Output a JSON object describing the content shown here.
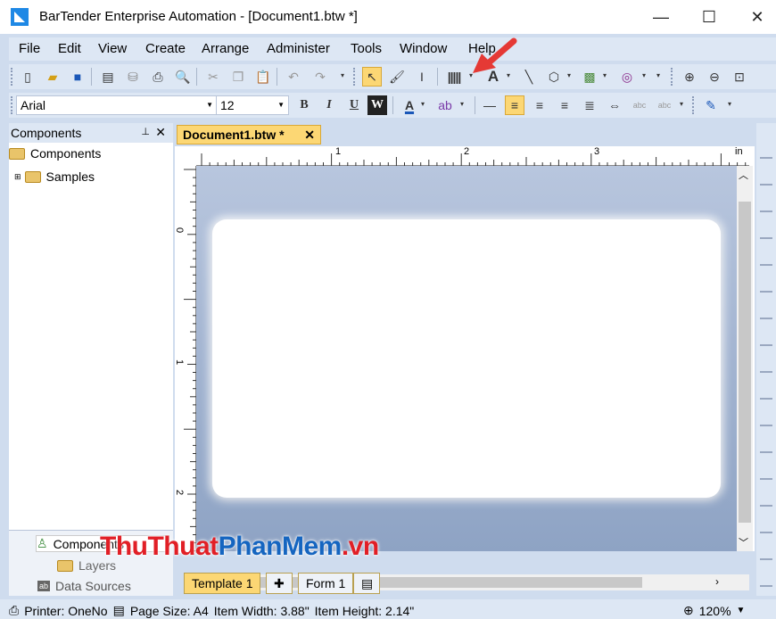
{
  "window": {
    "title": "BarTender Enterprise Automation - [Document1.btw *]",
    "minimize": "—",
    "maximize": "☐",
    "close": "✕"
  },
  "menu": [
    "File",
    "Edit",
    "View",
    "Create",
    "Arrange",
    "Administer",
    "Tools",
    "Window",
    "Help"
  ],
  "font": {
    "name": "Arial",
    "size": "12"
  },
  "format_buttons": {
    "bold": "B",
    "italic": "I",
    "underline": "U",
    "word": "W",
    "color": "A"
  },
  "panel": {
    "title": "Components",
    "pin": "📌",
    "close": "✕",
    "root": "Components",
    "child": "Samples",
    "tabs": [
      "Components",
      "Layers",
      "Data Sources"
    ]
  },
  "document": {
    "tab": "Document1.btw *",
    "close": "✕",
    "ruler_h": [
      "1",
      "2",
      "3",
      "in"
    ],
    "ruler_v": [
      "0",
      "1",
      "2"
    ]
  },
  "bottom_tabs": [
    "Template 1",
    "Form 1"
  ],
  "status": {
    "printer": "Printer: OneNo",
    "page_size": "Page Size: A4",
    "item_width": "Item Width: 3.88\"",
    "item_height": "Item Height: 2.14\"",
    "zoom": "120%"
  },
  "watermark": {
    "part1": "ThuThuat",
    "part2": "PhanMem",
    "part3": ".vn"
  },
  "colors": {
    "accent": "#fcd774",
    "toolbar": "#dde7f4",
    "arrow": "#e53935"
  }
}
